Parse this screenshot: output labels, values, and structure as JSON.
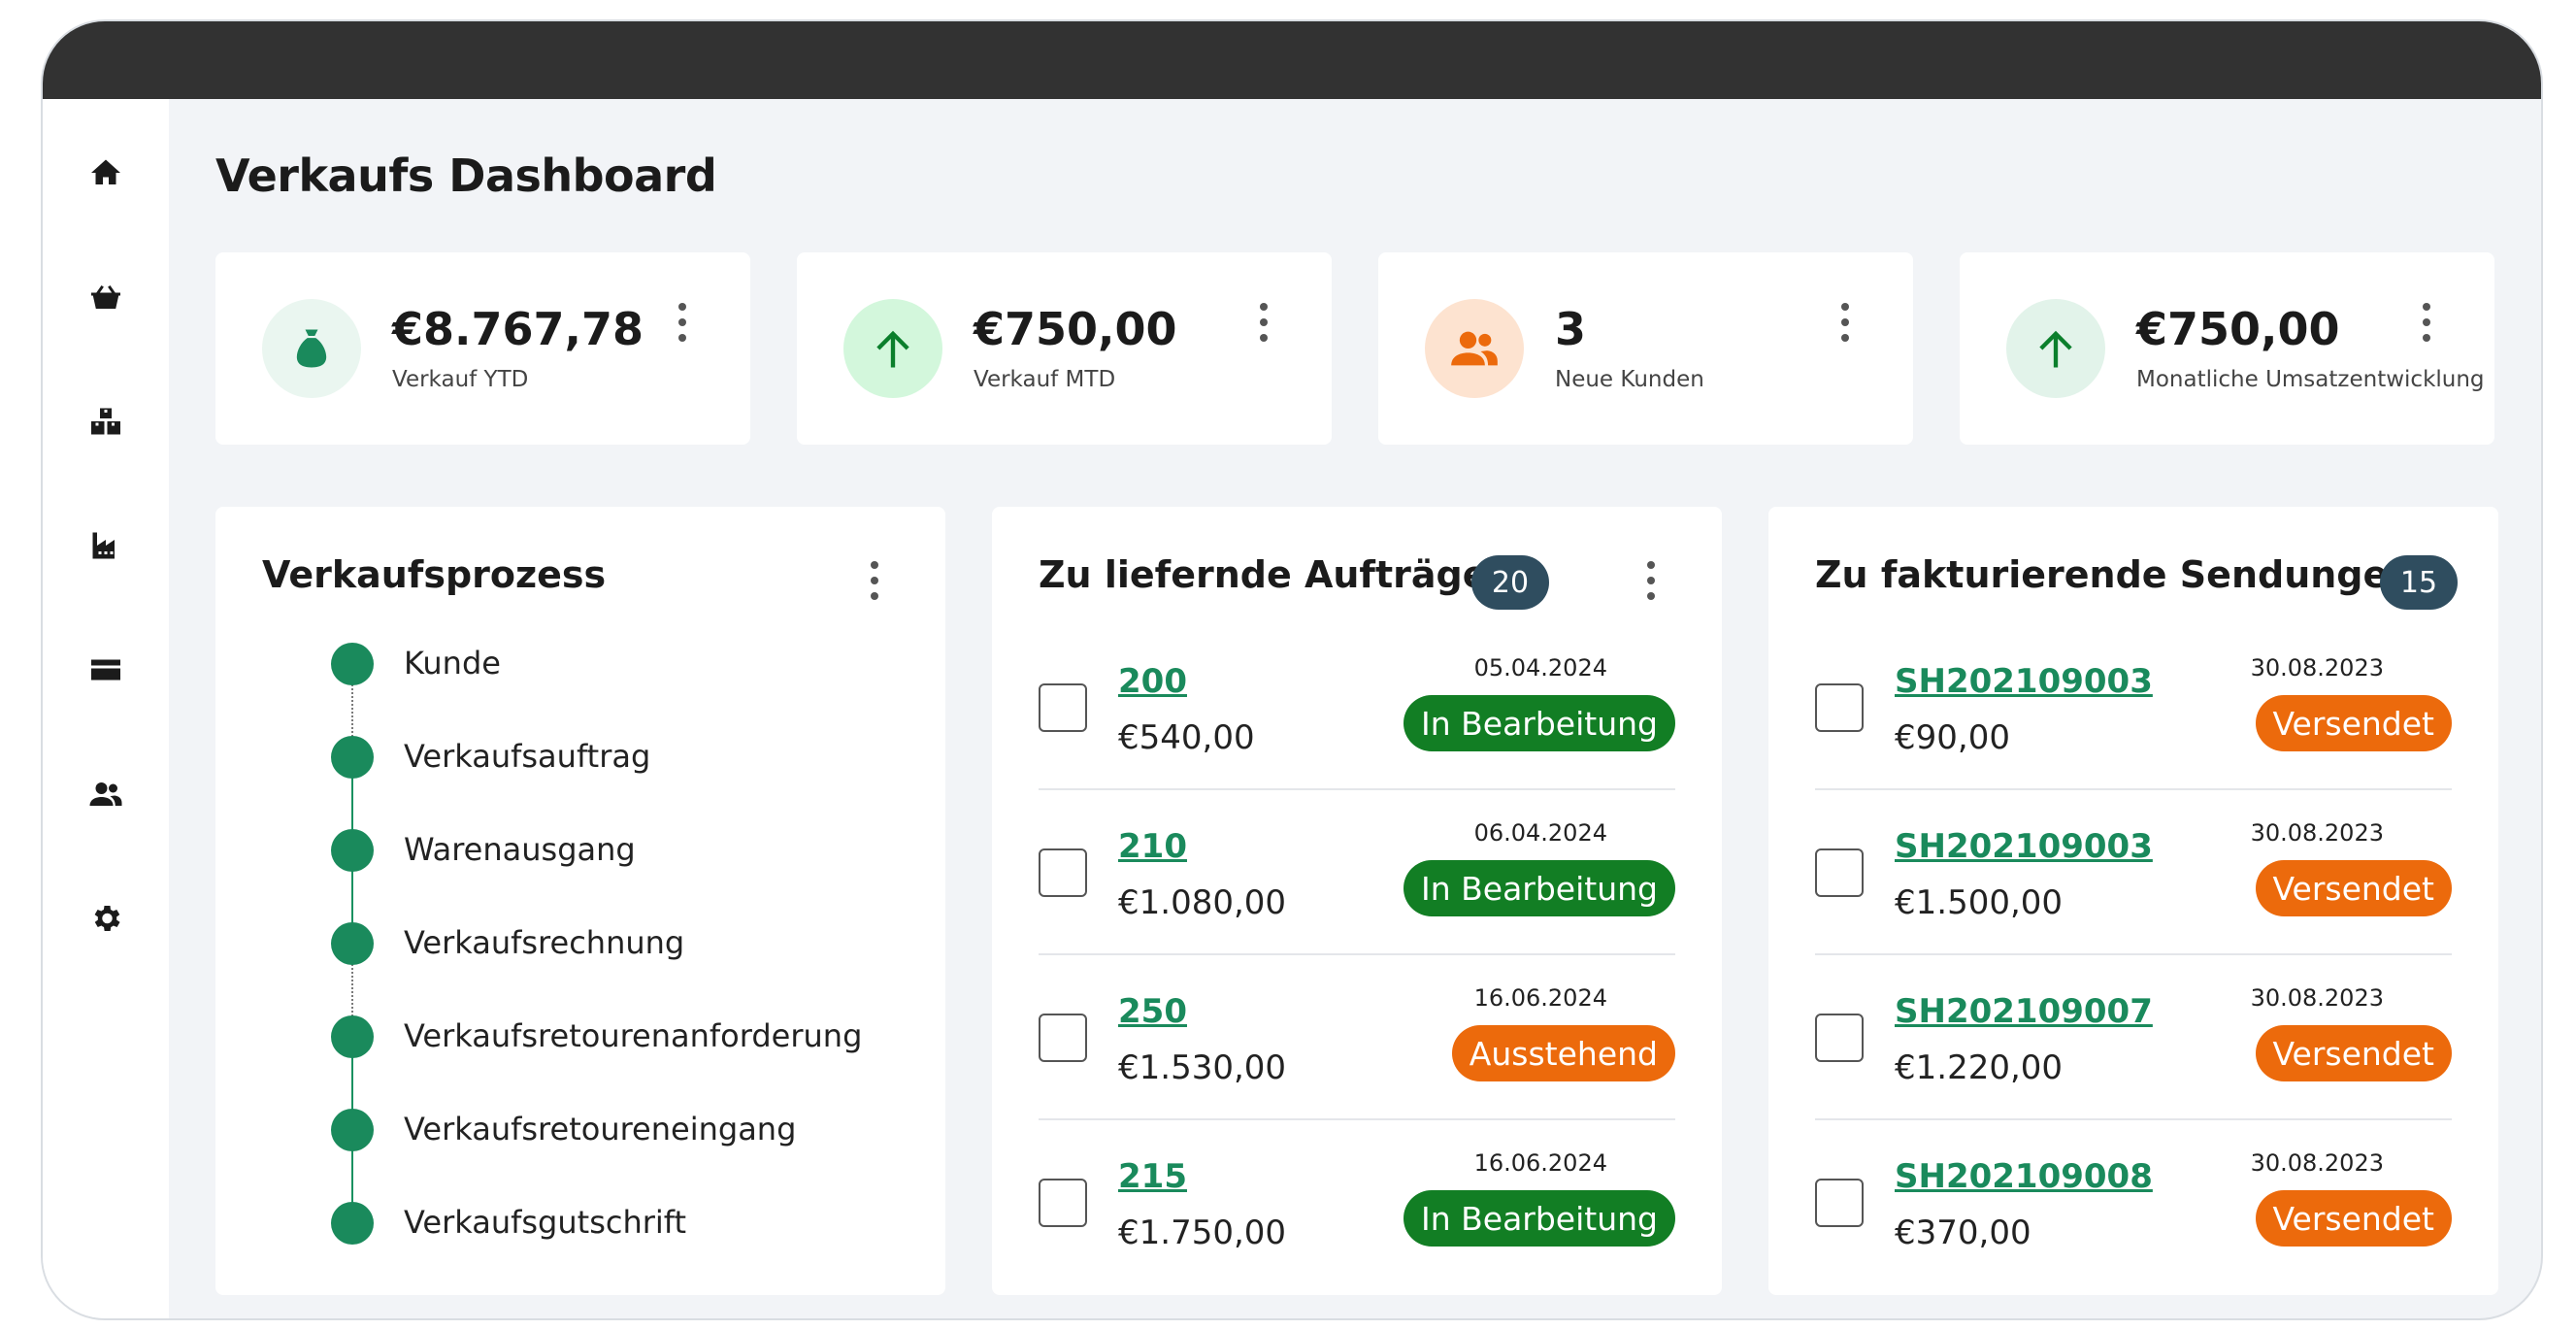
{
  "page_title": "Verkaufs Dashboard",
  "sidebar": {
    "items": [
      {
        "icon": "home-icon"
      },
      {
        "icon": "basket-icon"
      },
      {
        "icon": "boxes-icon"
      },
      {
        "icon": "factory-icon"
      },
      {
        "icon": "credit-card-icon"
      },
      {
        "icon": "users-icon"
      },
      {
        "icon": "gear-icon"
      }
    ]
  },
  "kpis": [
    {
      "value": "€8.767,78",
      "label": "Verkauf YTD",
      "icon": "money-bag-icon",
      "icon_color": "#1a8a5c",
      "circle_color": "#eaf6f0"
    },
    {
      "value": "€750,00",
      "label": "Verkauf MTD",
      "icon": "arrow-up-icon",
      "icon_color": "#0b7f2c",
      "circle_color": "#d3f7dc"
    },
    {
      "value": "3",
      "label": "Neue Kunden",
      "icon": "users-icon",
      "icon_color": "#ec6a0c",
      "circle_color": "#fde3d0"
    },
    {
      "value": "€750,00",
      "label": "Monatliche Umsatzentwicklung",
      "icon": "arrow-up-icon",
      "icon_color": "#0b7f2c",
      "circle_color": "#e2f3ea"
    }
  ],
  "process": {
    "title": "Verkaufsprozess",
    "steps": [
      "Kunde",
      "Verkaufsauftrag",
      "Warenausgang",
      "Verkaufsrechnung",
      "Verkaufsretourenanforderung",
      "Verkaufsretoureneingang",
      "Verkaufsgutschrift"
    ]
  },
  "orders": {
    "title": "Zu liefernde Aufträge",
    "count": "20",
    "rows": [
      {
        "id": "200",
        "amount": "€540,00",
        "date": "05.04.2024",
        "status": "In Bearbeitung"
      },
      {
        "id": "210",
        "amount": "€1.080,00",
        "date": "06.04.2024",
        "status": "In Bearbeitung"
      },
      {
        "id": "250",
        "amount": "€1.530,00",
        "date": "16.06.2024",
        "status": "Ausstehend"
      },
      {
        "id": "215",
        "amount": "€1.750,00",
        "date": "16.06.2024",
        "status": "In Bearbeitung"
      }
    ]
  },
  "shipments": {
    "title": "Zu fakturierende Sendungen",
    "count": "15",
    "rows": [
      {
        "id": "SH202109003",
        "amount": "€90,00",
        "date": "30.08.2023",
        "status": "Versendet"
      },
      {
        "id": "SH202109003",
        "amount": "€1.500,00",
        "date": "30.08.2023",
        "status": "Versendet"
      },
      {
        "id": "SH202109007",
        "amount": "€1.220,00",
        "date": "30.08.2023",
        "status": "Versendet"
      },
      {
        "id": "SH202109008",
        "amount": "€370,00",
        "date": "30.08.2023",
        "status": "Versendet"
      }
    ]
  },
  "colors": {
    "accent_green": "#1a8a5c",
    "status_green": "#127e24",
    "status_orange": "#ec6a0c",
    "badge_navy": "#2f4d5f",
    "titlebar": "#323232"
  }
}
